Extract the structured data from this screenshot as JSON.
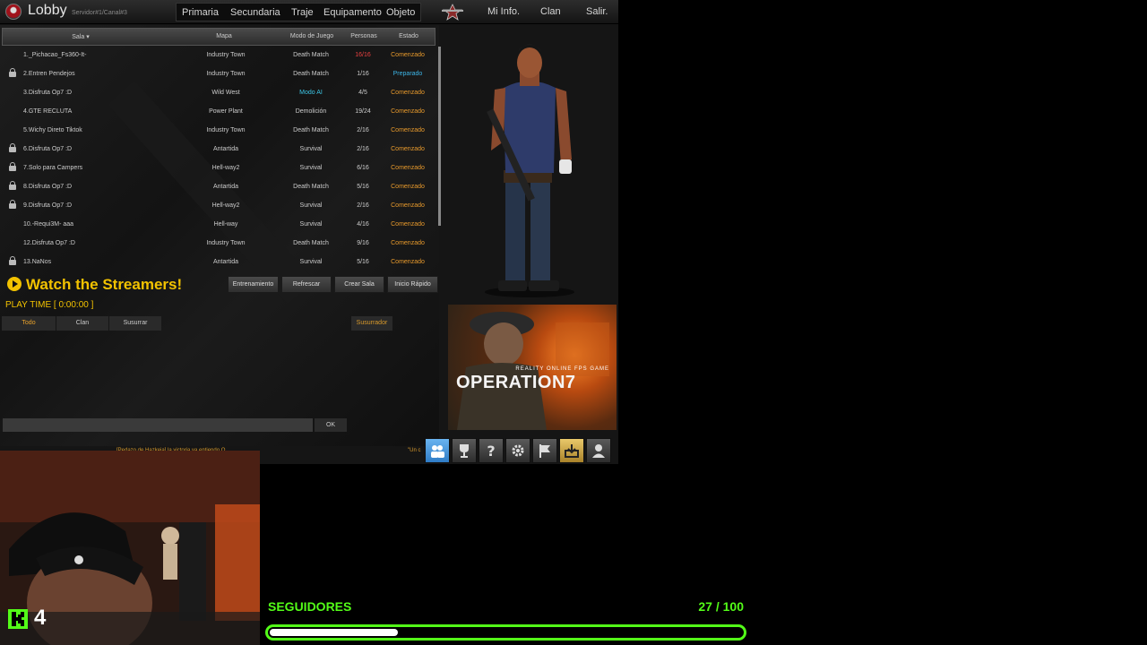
{
  "topbar": {
    "title": "Lobby",
    "server": "Servidor#1/Canal#3",
    "nav": [
      "Primaria",
      "Secundaria",
      "Traje",
      "Equipamento",
      "Objeto"
    ],
    "right": [
      "Mi Info.",
      "Clan",
      "Salir."
    ]
  },
  "table": {
    "headers": [
      "Sala ▾",
      "Mapa",
      "Modo de Juego",
      "Personas",
      "Estado"
    ],
    "rows": [
      {
        "name": "1._Pichacao_Fs360-It-",
        "map": "Industry Town",
        "mode": "Death Match",
        "players": "16/16",
        "status": "Comenzado",
        "locked": false
      },
      {
        "name": "2.Entren Pendejos",
        "map": "Industry Town",
        "mode": "Death Match",
        "players": "1/16",
        "status": "Preparado",
        "locked": true
      },
      {
        "name": "3.Disfruta Op7 :D",
        "map": "Wild West",
        "mode": "Modo AI",
        "players": "4/5",
        "status": "Comenzado",
        "locked": false
      },
      {
        "name": "4.GTE RECLUTA",
        "map": "Power Plant",
        "mode": "Demolición",
        "players": "19/24",
        "status": "Comenzado",
        "locked": false
      },
      {
        "name": "5.Wichy Direto Tiktok",
        "map": "Industry Town",
        "mode": "Death Match",
        "players": "2/16",
        "status": "Comenzado",
        "locked": false
      },
      {
        "name": "6.Disfruta Op7 :D",
        "map": "Antartida",
        "mode": "Survival",
        "players": "2/16",
        "status": "Comenzado",
        "locked": true
      },
      {
        "name": "7.Solo para Campers",
        "map": "Hell-way2",
        "mode": "Survival",
        "players": "6/16",
        "status": "Comenzado",
        "locked": true
      },
      {
        "name": "8.Disfruta Op7 :D",
        "map": "Antartida",
        "mode": "Death Match",
        "players": "5/16",
        "status": "Comenzado",
        "locked": true
      },
      {
        "name": "9.Disfruta Op7 :D",
        "map": "Hell-way2",
        "mode": "Survival",
        "players": "2/16",
        "status": "Comenzado",
        "locked": true
      },
      {
        "name": "10.-Requi3M- aaa",
        "map": "Hell-way",
        "mode": "Survival",
        "players": "4/16",
        "status": "Comenzado",
        "locked": false
      },
      {
        "name": "12.Disfruta Op7 :D",
        "map": "Industry Town",
        "mode": "Death Match",
        "players": "9/16",
        "status": "Comenzado",
        "locked": false
      },
      {
        "name": "13.NaNos",
        "map": "Antartida",
        "mode": "Survival",
        "players": "5/16",
        "status": "Comenzado",
        "locked": true
      }
    ]
  },
  "actions": [
    "Entrenamiento",
    "Refrescar",
    "Crear Sala",
    "Inicio Rápido"
  ],
  "watch": "Watch the Streamers!",
  "playtime": "PLAY TIME [ 0:00:00 ]",
  "chat_tabs": [
    "Todo",
    "Clan",
    "Susurrar"
  ],
  "whisper_label": "Susurrador",
  "ok": "OK",
  "ticker_left": "[Pedazo de Hazkeja] la victoria ya entiendo Q.",
  "ticker_right": "\"Un c",
  "ad": {
    "subtitle": "REALITY ONLINE FPS GAME",
    "title": "OPERATION7"
  },
  "overlay": {
    "k_count": "4",
    "label": "SEGUIDORES",
    "count": "27 / 100",
    "progress": 0.27
  },
  "colors": {
    "green": "#53fc18",
    "gold": "#f2c200",
    "status_started": "#e89a2c",
    "status_ready": "#3cb4e6",
    "full": "#e84040",
    "mode_ai": "#3cc6e6"
  }
}
